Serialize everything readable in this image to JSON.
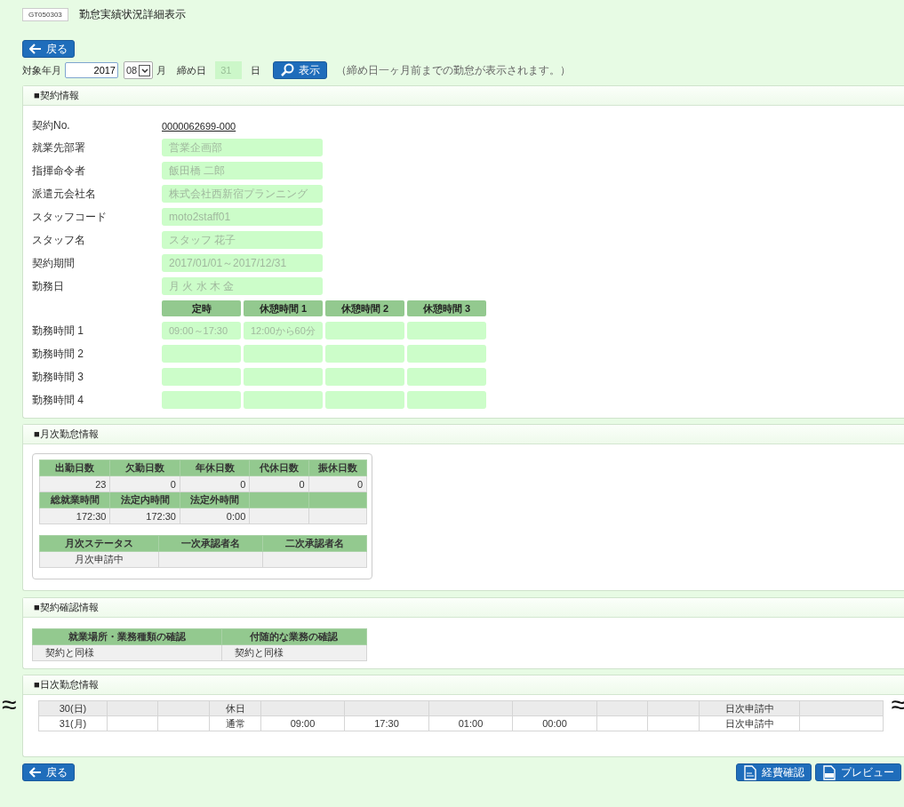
{
  "screen_id": "GT050303",
  "title": "勤怠実績状況詳細表示",
  "back_button": {
    "label": "戻る"
  },
  "filter": {
    "year_label": "対象年月",
    "year": "2017",
    "month": "08",
    "month_unit": "月",
    "closing_label": "締め日",
    "closing_day": "31",
    "day_unit": "日",
    "show_button": "表示",
    "note": "（締め日一ヶ月前までの勤怠が表示されます。）"
  },
  "contract": {
    "title": "■契約情報",
    "number_label": "契約No.",
    "number": "0000062699-000",
    "fields": [
      {
        "label": "就業先部署",
        "value": "営業企画部"
      },
      {
        "label": "指揮命令者",
        "value": "飯田橋 二郎"
      },
      {
        "label": "派遣元会社名",
        "value": "株式会社西新宿プランニング"
      },
      {
        "label": "スタッフコード",
        "value": "moto2staff01"
      },
      {
        "label": "スタッフ名",
        "value": "スタッフ 花子"
      },
      {
        "label": "契約期間",
        "value": "2017/01/01～2017/12/31"
      },
      {
        "label": "勤務日",
        "value": "月 火 水 木 金"
      }
    ],
    "time_columns": [
      "定時",
      "休憩時間 1",
      "休憩時間 2",
      "休憩時間 3"
    ],
    "time_rows": [
      {
        "label": "勤務時間 1",
        "values": [
          "09:00～17:30",
          "12:00から60分"
        ]
      },
      {
        "label": "勤務時間 2"
      },
      {
        "label": "勤務時間 3"
      },
      {
        "label": "勤務時間 4"
      }
    ]
  },
  "monthly": {
    "title": "■月次勤怠情報",
    "days_headers": [
      "出勤日数",
      "欠勤日数",
      "年休日数",
      "代休日数",
      "振休日数"
    ],
    "days_values": [
      "23",
      "0",
      "0",
      "0",
      "0"
    ],
    "hours_headers": [
      "総就業時間",
      "法定内時間",
      "法定外時間"
    ],
    "hours_values": [
      "172:30",
      "172:30",
      "0:00"
    ],
    "status_headers": [
      "月次ステータス",
      "一次承認者名",
      "二次承認者名"
    ],
    "status_values": [
      "月次申請中"
    ]
  },
  "confirmation": {
    "title": "■契約確認情報",
    "headers": [
      "就業場所・業務種類の確認",
      "付随的な業務の確認"
    ],
    "values": [
      "契約と同様",
      "契約と同様"
    ]
  },
  "daily": {
    "title": "■日次勤怠情報",
    "cut_marks": [
      "≈",
      "≈"
    ],
    "rows": [
      {
        "column_1": "30(日)",
        "column_4": "休日",
        "column_11": "日次申請中"
      },
      {
        "column_1": "31(月)",
        "column_4": "通常",
        "column_5": "09:00",
        "column_6": "17:30",
        "column_7": "01:00",
        "column_8": "00:00",
        "column_11": "日次申請中"
      }
    ]
  },
  "footer": {
    "back_button": "戻る",
    "expense_button": "経費確認",
    "preview_button": "プレビュー"
  }
}
